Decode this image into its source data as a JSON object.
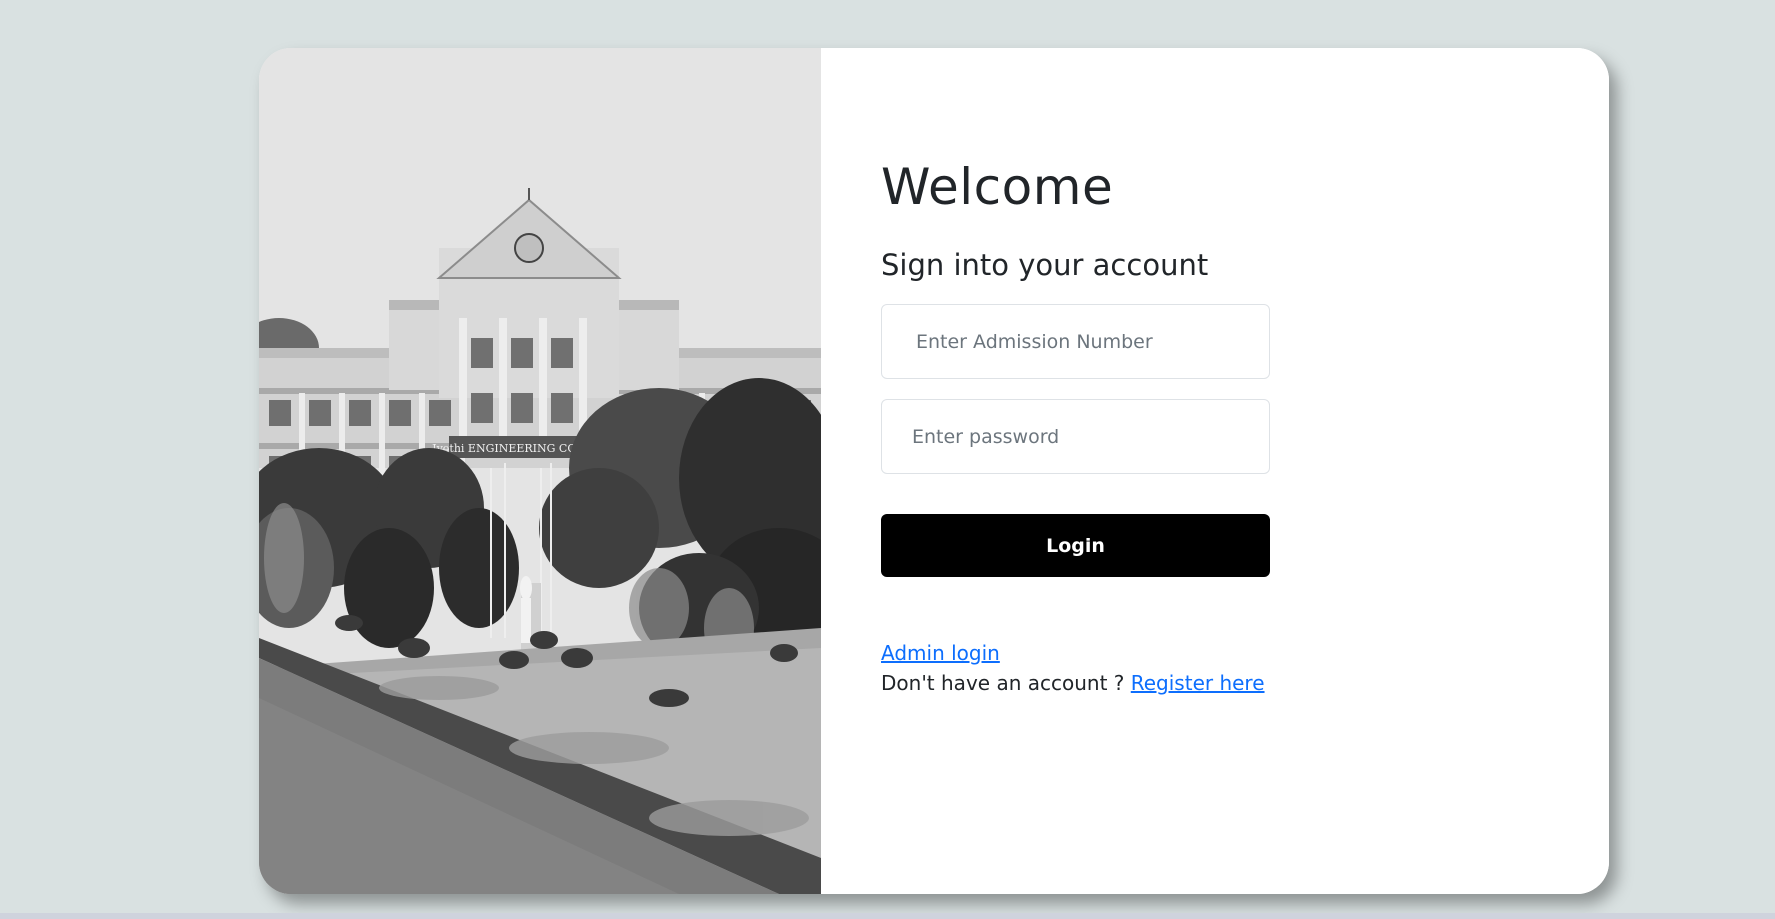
{
  "image": {
    "sign_text": "Jyothi ENGINEERING COLLEGE",
    "description_name": "campus-building-photo"
  },
  "form": {
    "welcome": "Welcome",
    "subtitle": "Sign into your account",
    "admission_placeholder": "Enter Admission Number",
    "password_placeholder": "Enter password",
    "login_label": "Login",
    "admin_link": "Admin login",
    "register_prompt": "Don't have an account ?",
    "register_link": "Register here"
  },
  "colors": {
    "page_background": "#d9e1e1",
    "button": "#000000",
    "link": "#0d6efd"
  }
}
